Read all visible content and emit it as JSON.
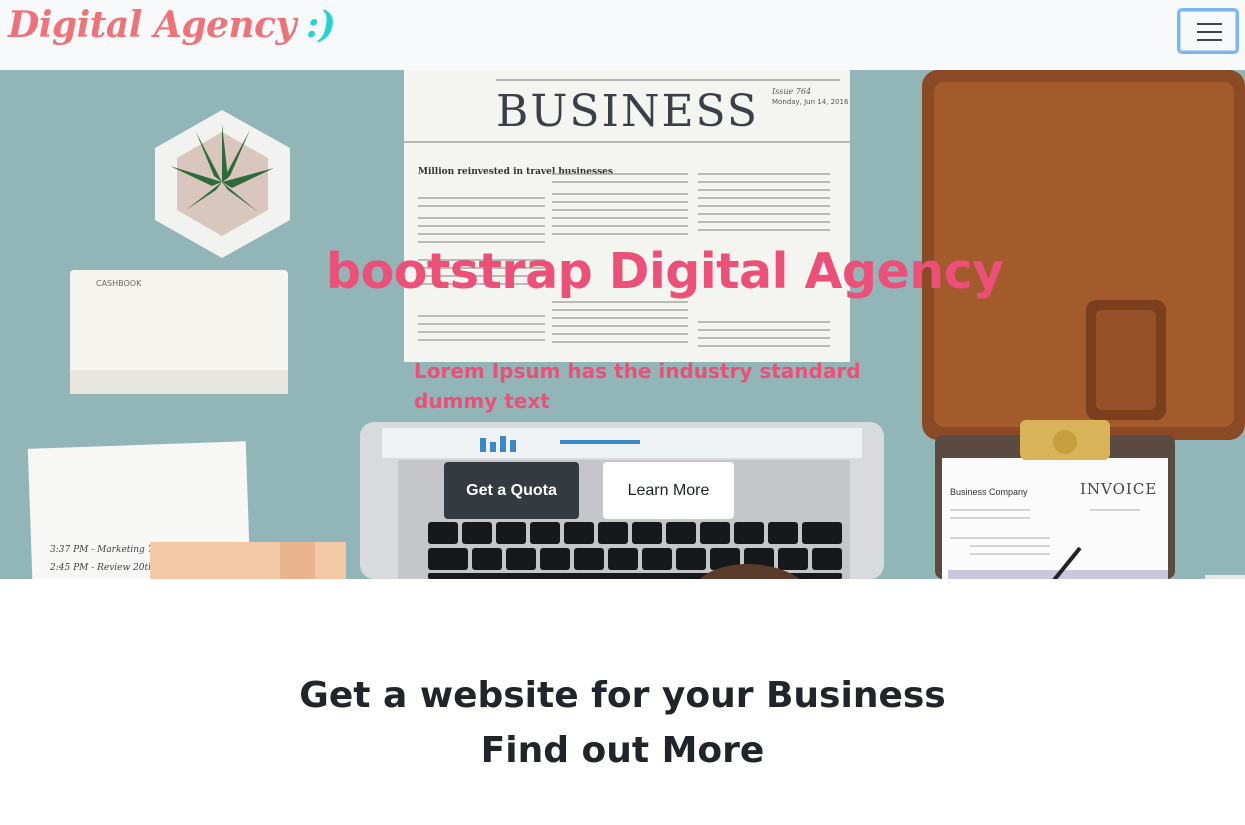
{
  "navbar": {
    "brand_text": "Digital Agency",
    "brand_smiley": ":)",
    "menu_icon": "hamburger-menu-icon"
  },
  "hero": {
    "title": "bootstrap Digital Agency",
    "subtitle": "Lorem Ipsum has the industry standard dummy text",
    "primary_button": "Get a Quota",
    "secondary_button": "Learn More",
    "newspaper_heading": "BUSINESS",
    "newspaper_issue": "Issue 764",
    "newspaper_date": "Monday, Jun 14, 2016",
    "newspaper_headline": "Million reinvested in travel businesses",
    "cashbook_label": "CASHBOOK",
    "invoice_company": "Business Company",
    "invoice_label": "INVOICE"
  },
  "section": {
    "line1": "Get a website for your Business",
    "line2": "Find out More"
  },
  "colors": {
    "brand": "#f07279",
    "smiley": "#22d3d3",
    "hero_text": "#ec4f78",
    "dark_button": "#343a40"
  }
}
